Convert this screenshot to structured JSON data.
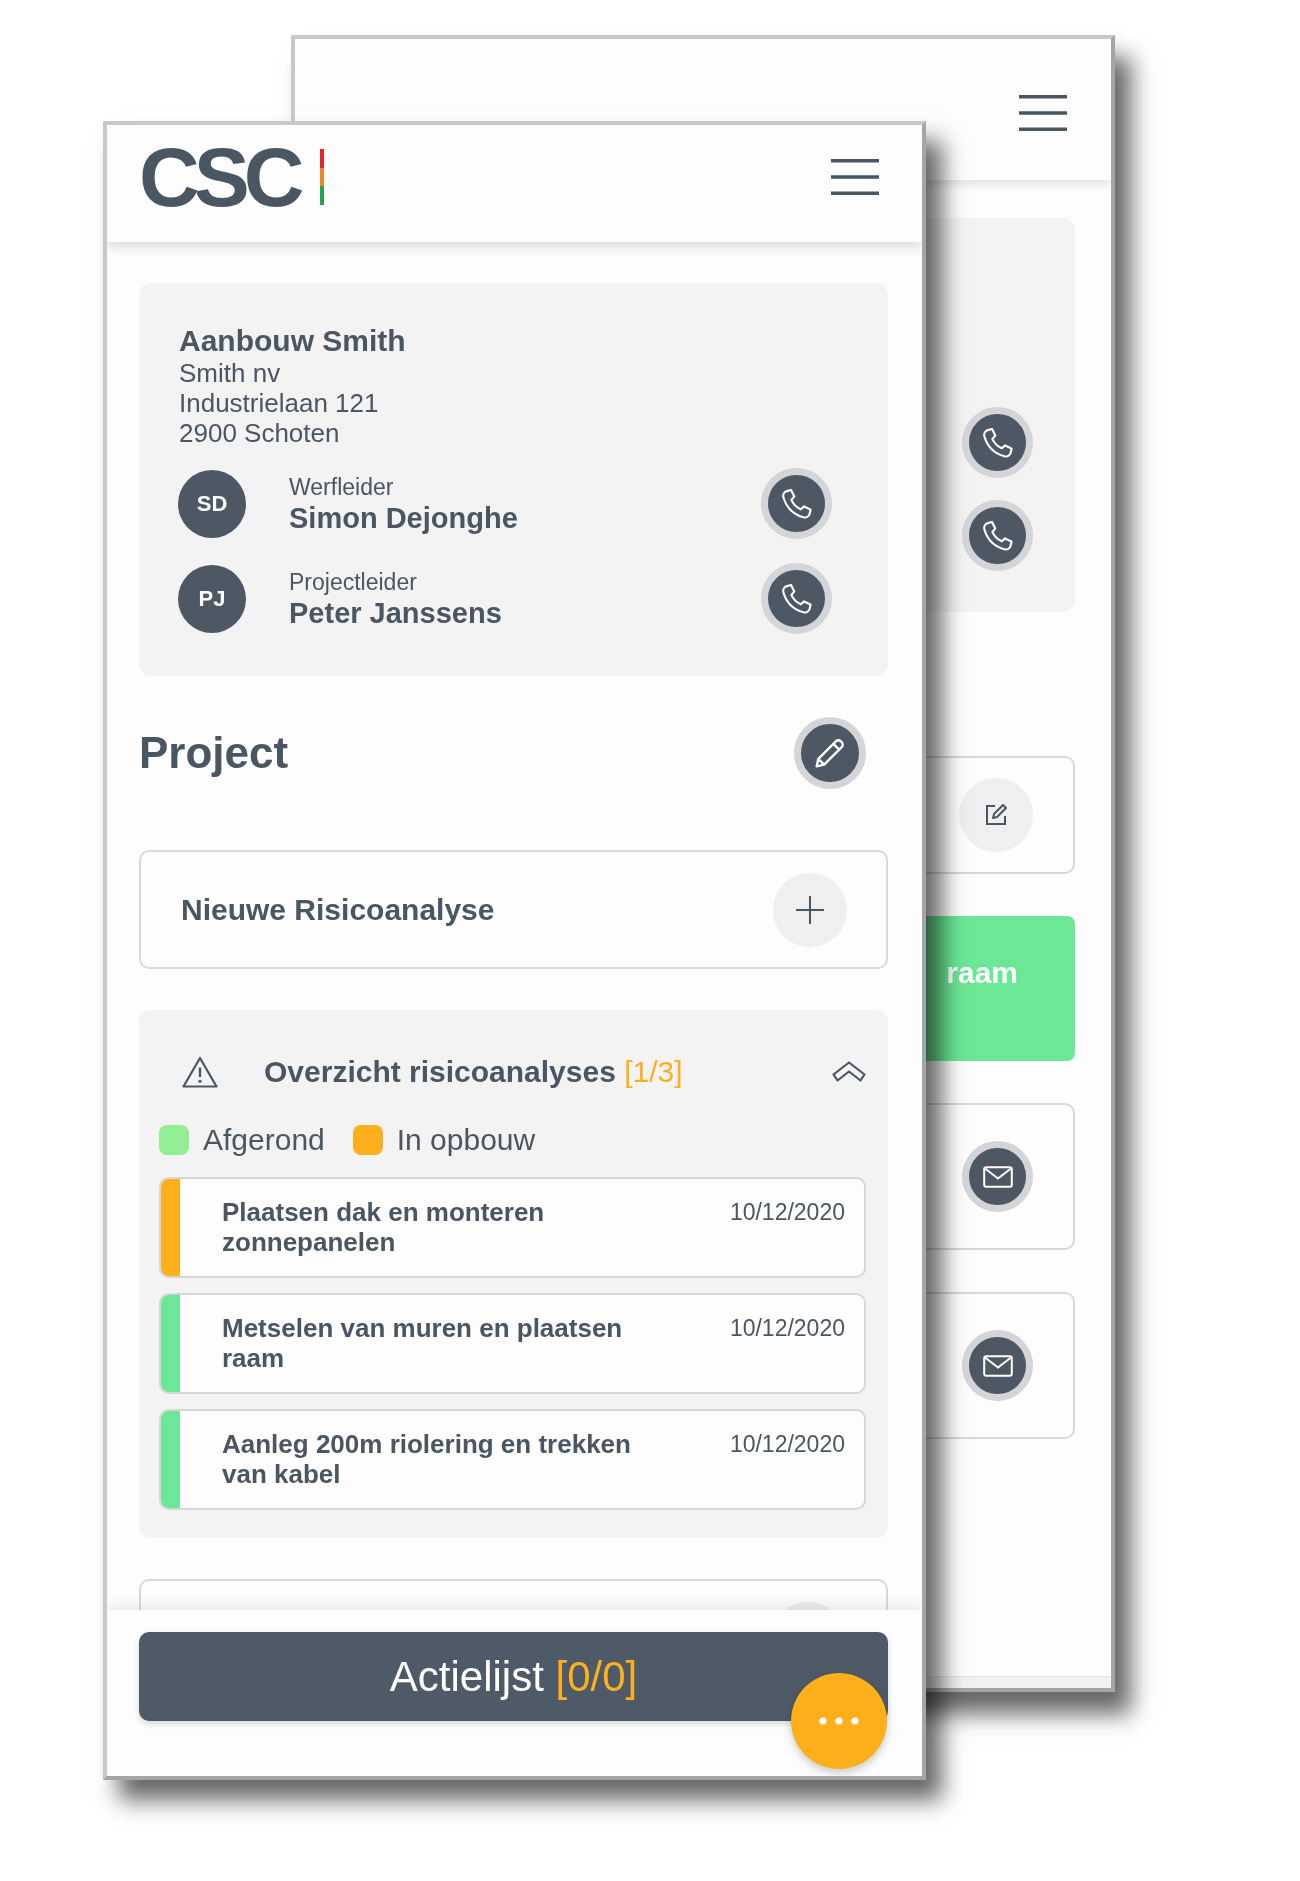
{
  "back_screen": {
    "cards": [
      {
        "kind": "contacts"
      },
      {
        "kind": "edit"
      },
      {
        "kind": "finished",
        "title": "raam"
      },
      {
        "kind": "mail"
      },
      {
        "kind": "mail"
      }
    ]
  },
  "front_screen": {
    "header": {
      "logo": "CSC"
    },
    "site": {
      "name": "Aanbouw Smith",
      "address": [
        "Smith nv",
        "Industrielaan 121",
        "2900 Schoten"
      ],
      "contacts": [
        {
          "initials": "SD",
          "role": "Werfleider",
          "name": "Simon Dejonghe"
        },
        {
          "initials": "PJ",
          "role": "Projectleider",
          "name": "Peter Janssens"
        }
      ]
    },
    "project": {
      "title": "Project"
    },
    "new_analysis": {
      "label": "Nieuwe Risicoanalyse"
    },
    "overview": {
      "title": "Overzicht risicoanalyses",
      "count": "[1/3]",
      "expanded": true,
      "legend": [
        {
          "label": "Afgerond",
          "color": "#94ee94"
        },
        {
          "label": "In opbouw",
          "color": "#fdb01c"
        }
      ],
      "items": [
        {
          "title": "Plaatsen dak en monteren zonnepanelen",
          "date": "10/12/2020",
          "color": "#fdb01c"
        },
        {
          "title": "Metselen van muren en plaatsen raam",
          "date": "10/12/2020",
          "color": "#6be797"
        },
        {
          "title": "Aanleg 200m riolering en trekken van kabel",
          "date": "10/12/2020",
          "color": "#6be797"
        }
      ]
    },
    "action_list": {
      "label": "Actielijst",
      "count": "[0/0]"
    }
  }
}
